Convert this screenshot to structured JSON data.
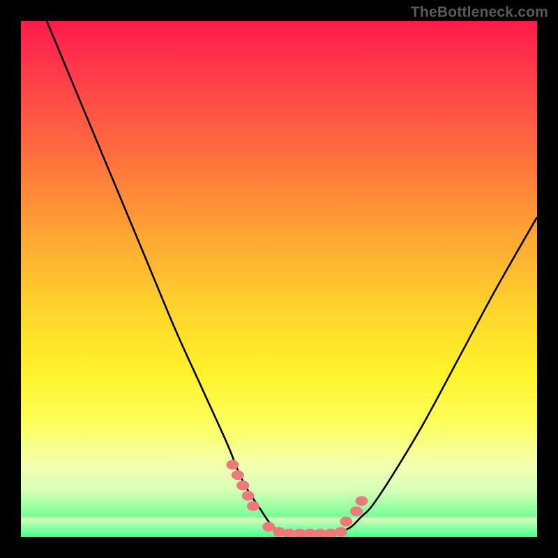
{
  "watermark": "TheBottleneck.com",
  "colors": {
    "curve": "#000000",
    "markers_fill": "#ed7a7a",
    "markers_stroke": "#c84f4f",
    "background_black": "#000000"
  },
  "chart_data": {
    "type": "line",
    "title": "",
    "xlabel": "",
    "ylabel": "",
    "xlim": [
      0,
      100
    ],
    "ylim": [
      0,
      100
    ],
    "series": [
      {
        "name": "left-curve",
        "x": [
          5,
          10,
          15,
          20,
          25,
          30,
          35,
          40,
          42,
          44,
          46,
          48,
          50
        ],
        "y": [
          100,
          88,
          76,
          64,
          52,
          40,
          29,
          18,
          13,
          9,
          6,
          3,
          1
        ]
      },
      {
        "name": "right-curve",
        "x": [
          62,
          64,
          66,
          68,
          72,
          78,
          85,
          92,
          100
        ],
        "y": [
          1,
          2,
          4,
          6,
          12,
          22,
          35,
          48,
          62
        ]
      },
      {
        "name": "flat-bottom",
        "x": [
          50,
          52,
          54,
          56,
          58,
          60,
          62
        ],
        "y": [
          1,
          0.5,
          0.5,
          0.5,
          0.5,
          0.5,
          1
        ]
      }
    ],
    "markers": [
      {
        "x": 41,
        "y": 14
      },
      {
        "x": 42,
        "y": 12
      },
      {
        "x": 43,
        "y": 10
      },
      {
        "x": 44,
        "y": 8
      },
      {
        "x": 45,
        "y": 6
      },
      {
        "x": 48,
        "y": 2
      },
      {
        "x": 50,
        "y": 1
      },
      {
        "x": 52,
        "y": 0.7
      },
      {
        "x": 54,
        "y": 0.7
      },
      {
        "x": 56,
        "y": 0.7
      },
      {
        "x": 58,
        "y": 0.7
      },
      {
        "x": 60,
        "y": 0.7
      },
      {
        "x": 62,
        "y": 1
      },
      {
        "x": 63,
        "y": 3
      },
      {
        "x": 65,
        "y": 5
      },
      {
        "x": 66,
        "y": 7
      }
    ]
  }
}
